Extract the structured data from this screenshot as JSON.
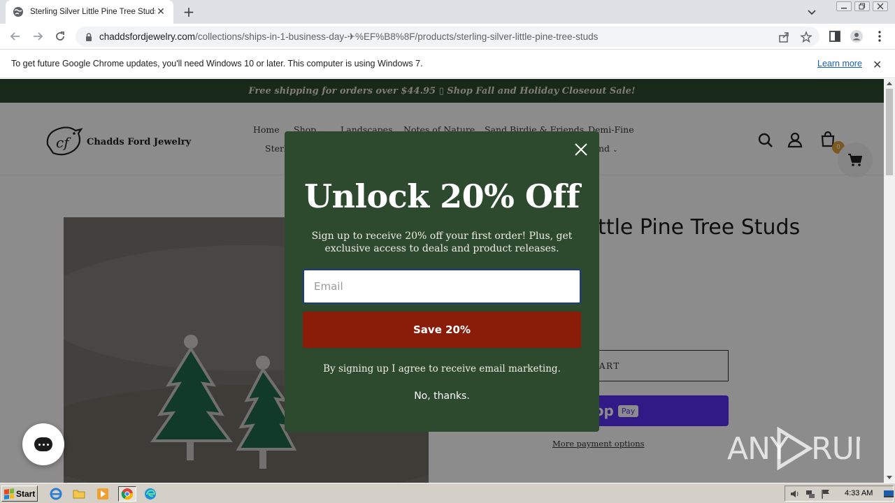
{
  "browser": {
    "tab_title": "Sterling Silver Little Pine Tree Studs –",
    "url_domain": "chaddsfordjewelry.com",
    "url_path": "/collections/ships-in-1-business-day-✈%EF%B8%8F/products/sterling-silver-little-pine-tree-studs",
    "infobar_text": "To get future Google Chrome updates, you'll need Windows 10 or later. This computer is using Windows 7.",
    "infobar_link": "Learn more"
  },
  "site": {
    "announcement": "Free shipping for orders over $44.95 ▯ Shop Fall and Holiday Closeout Sale!",
    "logo_text": "Chadds Ford Jewelry",
    "nav": {
      "home": "Home",
      "shop": "Shop",
      "landscapes": "Landscapes",
      "notes": "Notes of Nature",
      "sand_birdie": "Sand Birdie & Friends",
      "demi_fine": "Demi-Fine",
      "sterling_partial": "Sterli",
      "brand_partial": "nd"
    },
    "cart_count": "0"
  },
  "product": {
    "title_partial": "Little Pine Tree Studs",
    "add_to_cart_partial": "CART",
    "shoppay_label_partial": "op",
    "shoppay_pay": "Pay",
    "more_payment": "More payment options"
  },
  "modal": {
    "heading": "Unlock 20% Off",
    "subtext": "Sign up to receive 20% off your first order! Plus, get exclusive access to deals and product releases.",
    "email_placeholder": "Email",
    "email_value": "",
    "save_button": "Save 20%",
    "consent": "By signing up I agree to receive email marketing.",
    "no_thanks": "No, thanks."
  },
  "watermark": "ANY RUN",
  "taskbar": {
    "start_label": "Start",
    "clock": "4:33 AM"
  },
  "colors": {
    "brand_green": "#2d4a2e",
    "save_red": "#8a1d0a",
    "shoppay_purple": "#5a31f4"
  }
}
